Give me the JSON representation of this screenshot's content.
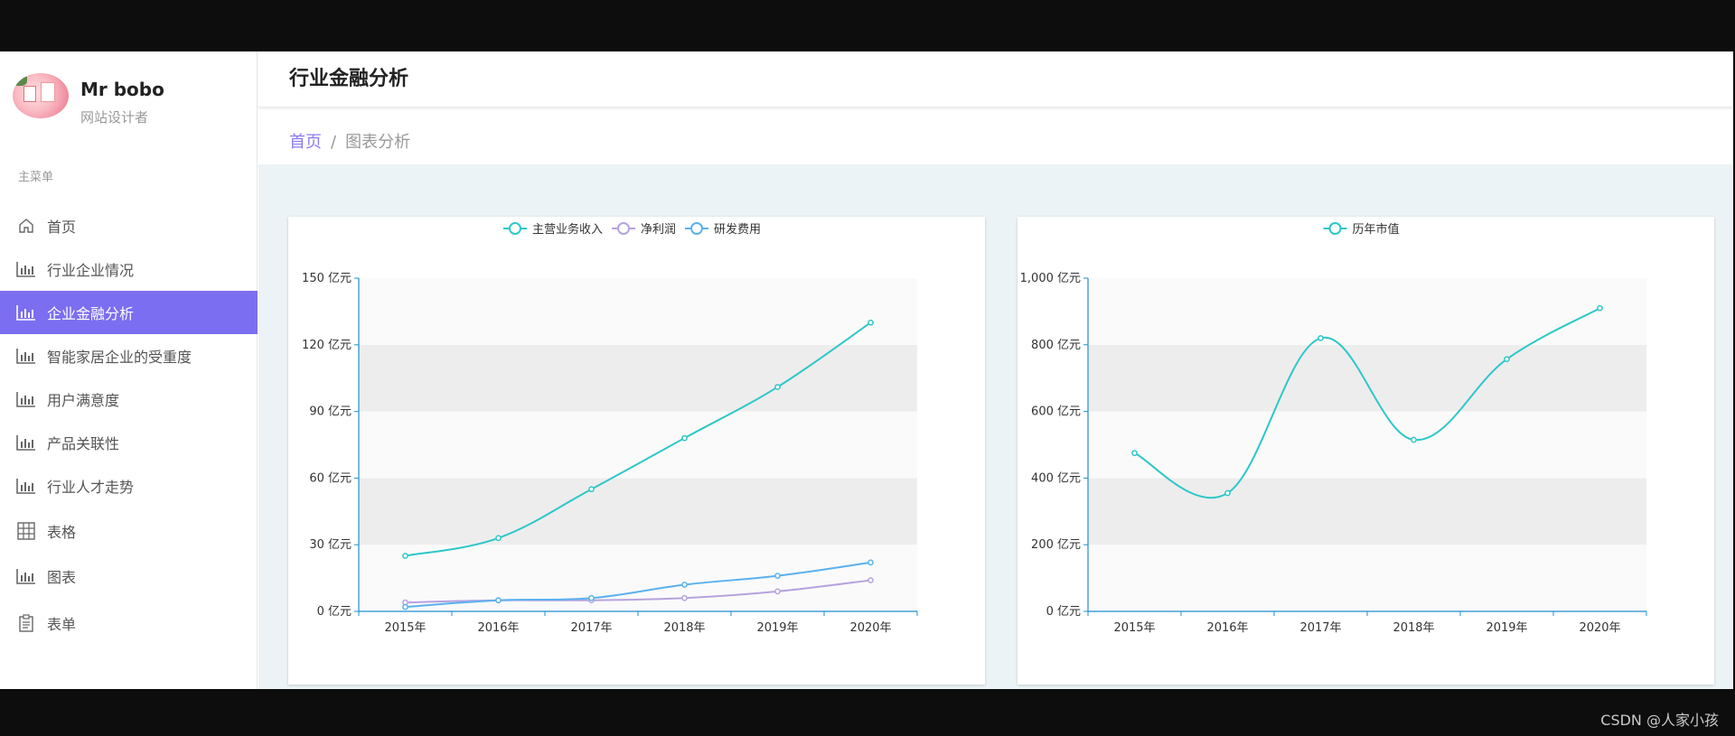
{
  "profile": {
    "name": "Mr bobo",
    "role": "网站设计者"
  },
  "menu_title": "主菜单",
  "menu": [
    {
      "label": "首页",
      "icon": "home-icon"
    },
    {
      "label": "行业企业情况",
      "icon": "bar-chart-icon"
    },
    {
      "label": "企业金融分析",
      "icon": "bar-chart-icon",
      "active": true
    },
    {
      "label": "智能家居企业的受重度",
      "icon": "bar-chart-icon"
    },
    {
      "label": "用户满意度",
      "icon": "bar-chart-icon"
    },
    {
      "label": "产品关联性",
      "icon": "bar-chart-icon"
    },
    {
      "label": "行业人才走势",
      "icon": "bar-chart-icon"
    },
    {
      "label": "表格",
      "icon": "table-grid-icon"
    },
    {
      "label": "图表",
      "icon": "bar-chart-icon"
    },
    {
      "label": "表单",
      "icon": "clipboard-icon"
    }
  ],
  "header": {
    "title": "行业金融分析"
  },
  "breadcrumb": {
    "home": "首页",
    "separator": "/",
    "current": "图表分析"
  },
  "watermark": "CSDN @人家小孩",
  "colors": {
    "accent": "#7c6ef0",
    "teal": "#2ec7c9",
    "purple": "#b6a2de",
    "blue": "#5ab1ef"
  },
  "chart_data": [
    {
      "type": "line",
      "categories": [
        "2015年",
        "2016年",
        "2017年",
        "2018年",
        "2019年",
        "2020年"
      ],
      "series": [
        {
          "name": "主营业务收入",
          "color": "#2ec7c9",
          "values": [
            25,
            33,
            55,
            78,
            101,
            130
          ]
        },
        {
          "name": "净利润",
          "color": "#b6a2de",
          "values": [
            4,
            5,
            5,
            6,
            9,
            14
          ]
        },
        {
          "name": "研发费用",
          "color": "#5ab1ef",
          "values": [
            2,
            5,
            6,
            12,
            16,
            22
          ]
        }
      ],
      "yticks": [
        "0 亿元",
        "30 亿元",
        "60 亿元",
        "90 亿元",
        "120 亿元",
        "150 亿元"
      ],
      "ylim": [
        0,
        150
      ],
      "smooth": true,
      "legend": "top-center",
      "split_area": true
    },
    {
      "type": "line",
      "categories": [
        "2015年",
        "2016年",
        "2017年",
        "2018年",
        "2019年",
        "2020年"
      ],
      "series": [
        {
          "name": "历年市值",
          "color": "#2ec7c9",
          "values": [
            475,
            355,
            820,
            515,
            757,
            910
          ]
        }
      ],
      "yticks": [
        "0 亿元",
        "200 亿元",
        "400 亿元",
        "600 亿元",
        "800 亿元",
        "1,000 亿元"
      ],
      "ylim": [
        0,
        1000
      ],
      "smooth": true,
      "legend": "top-center",
      "split_area": true
    }
  ]
}
